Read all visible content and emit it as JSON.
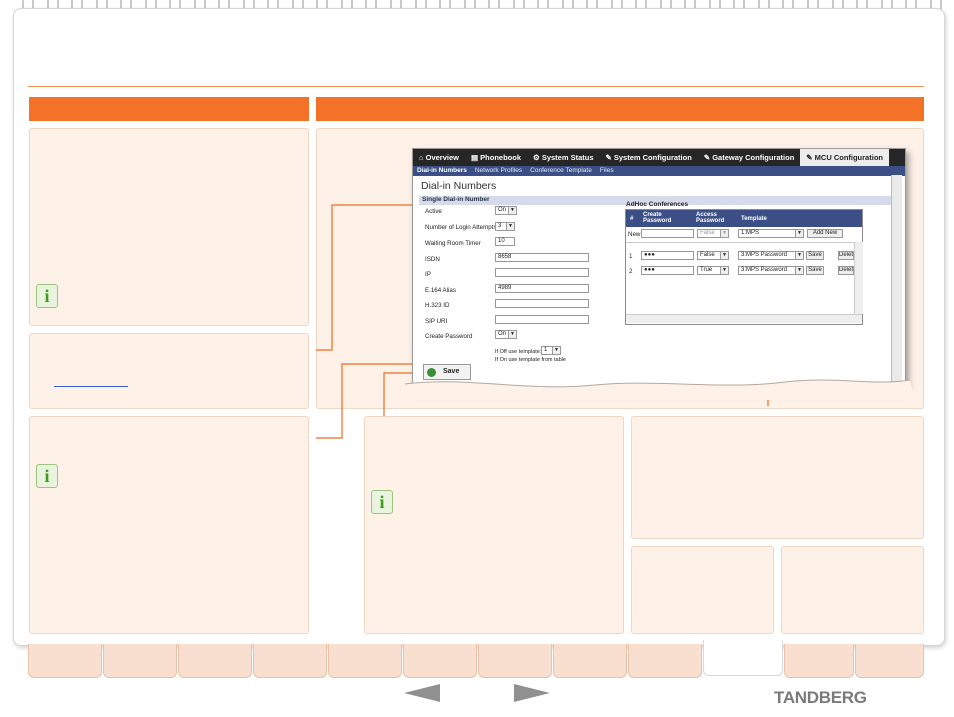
{
  "screenshot": {
    "top_tabs": [
      "Overview",
      "Phonebook",
      "System Status",
      "System Configuration",
      "Gateway Configuration",
      "MCU Configuration"
    ],
    "active_top_tab": "MCU Configuration",
    "sub_tabs": [
      "Dial-in Numbers",
      "Network Profiles",
      "Conference Template",
      "Files"
    ],
    "active_sub_tab": "Dial-in Numbers",
    "page_title": "Dial-in Numbers",
    "section_title": "Single Dial-in Number",
    "fields": {
      "active": {
        "label": "Active",
        "value": "On"
      },
      "login_attempts": {
        "label": "Number of Login Attempts",
        "value": "3"
      },
      "waiting_room": {
        "label": "Waiting Room Timer",
        "value": "10"
      },
      "isdn": {
        "label": "ISDN",
        "value": "8658"
      },
      "ip": {
        "label": "IP",
        "value": ""
      },
      "e164": {
        "label": "E.164 Alias",
        "value": "4989"
      },
      "h323": {
        "label": "H.323 ID",
        "value": ""
      },
      "sip": {
        "label": "SIP URI",
        "value": ""
      },
      "create_password": {
        "label": "Create Password",
        "value": "On"
      }
    },
    "template_note1": "If Off use template:",
    "template_note1_value": "1",
    "template_note2": "If On use template from table",
    "save_label": "Save",
    "adhoc": {
      "title": "AdHoc Conferences",
      "col_hash": "#",
      "col_create": "Create Password",
      "col_access": "Access Password",
      "col_template": "Template",
      "new_label": "New",
      "new_access": "False",
      "new_template": "1:MPS",
      "add_new": "Add New",
      "save": "Save",
      "delete": "Delete",
      "rows": [
        {
          "num": "1",
          "password": "●●●",
          "access": "False",
          "template": "3:MPS Password"
        },
        {
          "num": "2",
          "password": "●●●",
          "access": "True",
          "template": "3:MPS Password"
        }
      ]
    }
  },
  "brand": "TANDBERG",
  "info_glyph": "i",
  "colors": {
    "orange": "#f47228",
    "panel": "#fdf1e8",
    "nav_dark": "#262626",
    "nav_blue": "#3b4f86"
  }
}
